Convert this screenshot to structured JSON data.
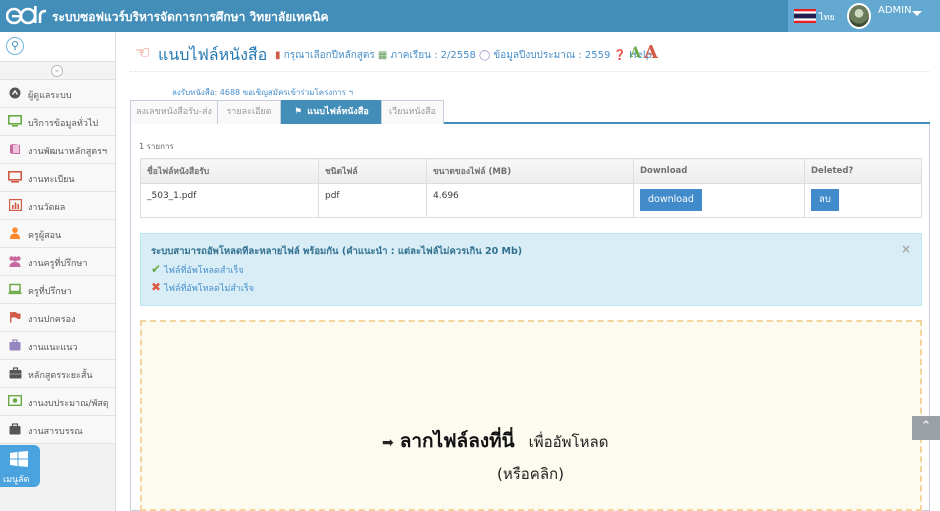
{
  "header": {
    "logo_text": "edr",
    "title": "ระบบซอฟแวร์บริหารจัดการการศึกษา วิทยาลัยเทคนิค",
    "language": "ไทย",
    "user": "ADMIN",
    "colors": {
      "bar": "#438eb9",
      "user_area": "#62a8d1"
    }
  },
  "sidebar": {
    "search_icon": "search-icon",
    "items": [
      {
        "label": "ผู้ดูแลระบบ",
        "icon": "gear-circle-icon",
        "color": "#555555"
      },
      {
        "label": "บริการข้อมูลทั่วไป",
        "icon": "monitor-icon",
        "color": "#69aa46"
      },
      {
        "label": "งานพัฒนาหลักสูตรฯ",
        "icon": "book-icon",
        "color": "#c6699f"
      },
      {
        "label": "งานทะเบียน",
        "icon": "desktop-icon",
        "color": "#d15b47"
      },
      {
        "label": "งานวัดผล",
        "icon": "bar-chart-icon",
        "color": "#d15b47"
      },
      {
        "label": "ครูผู้สอน",
        "icon": "user-icon",
        "color": "#ff892a"
      },
      {
        "label": "งานครูที่ปรึกษา",
        "icon": "users-icon",
        "color": "#c6699f"
      },
      {
        "label": "ครูที่ปรึกษา",
        "icon": "laptop-icon",
        "color": "#69aa46"
      },
      {
        "label": "งานปกครอง",
        "icon": "flag-icon",
        "color": "#d15b47"
      },
      {
        "label": "งานแนะแนว",
        "icon": "suitcase-icon",
        "color": "#9585bf"
      },
      {
        "label": "หลักสูตรระยะสั้น",
        "icon": "briefcase-icon",
        "color": "#555555"
      },
      {
        "label": "งานงบประมาณ/พัสดุ",
        "icon": "money-icon",
        "color": "#69aa46"
      },
      {
        "label": "งานสารบรรณ",
        "icon": "archive-icon",
        "color": "#555555"
      }
    ],
    "menu_button": "เมนูลัด"
  },
  "page": {
    "title": "แนบไฟล์หนังสือ",
    "curriculum_hint": "กรุณาเลือกปีหลักสูตร",
    "term": "ภาคเรียน : 2/2558",
    "budget_year": "ข้อมูลปีงบประมาณ : 2559",
    "help": "Help",
    "font_small": "A",
    "font_large": "A",
    "subnote": "ลงรับหนังสือ: 4688 ขอเชิญสมัครเข้าร่วมโครงการ ฯ"
  },
  "tabs": [
    {
      "label": "ลงเลขหนังสือรับ-ส่ง",
      "active": false
    },
    {
      "label": "รายละเอียด",
      "active": false
    },
    {
      "label": "แนบไฟล์หนังสือ",
      "active": true
    },
    {
      "label": "เวียนหนังสือ",
      "active": false
    }
  ],
  "files": {
    "count": "1 รายการ",
    "columns": [
      "ชื่อไฟล์หนังสือรับ",
      "ชนิดไฟล์",
      "ขนาดของไฟล์ (MB)",
      "Download",
      "Deleted?"
    ],
    "rows": [
      {
        "name": "_503_1.pdf",
        "type": "pdf",
        "size": "4.696",
        "download": "download",
        "delete": "ลบ"
      }
    ]
  },
  "alert": {
    "title": "ระบบสามารถอัพโหลดทีละหลายไฟล์ พร้อมกัน (คำแนะนำ : แต่ละไฟล์ไม่ควรเกิน 20 Mb)",
    "success": "ไฟล์ที่อัพโหลดสำเร็จ",
    "failed": "ไฟล์ที่อัพโหลดไม่สำเร็จ",
    "close": "×"
  },
  "dropzone": {
    "main": "ลากไฟล์ลงที่นี่",
    "rest": "เพื่ออัพโหลด",
    "sub": "(หรือคลิก)"
  }
}
